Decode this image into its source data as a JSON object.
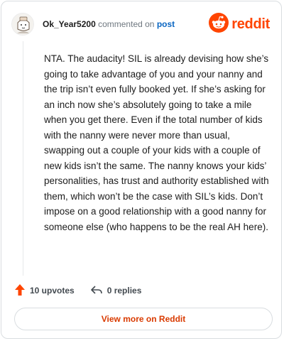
{
  "header": {
    "username": "Ok_Year5200",
    "action_text": "commented on",
    "post_link": "post",
    "brand": "reddit"
  },
  "comment": {
    "text": "NTA. The audacity! SIL is already devising how she’s going to take advantage of you and your nanny and the trip isn’t even fully booked yet. If she’s asking for an inch now she’s absolutely going to take a mile when you get there. Even if the total number of kids with the nanny were never more than usual, swapping out a couple of your kids with a couple of new kids isn’t the same. The nanny knows your kids’ personalities, has trust and authority established with them, which won’t be the case with SIL’s kids. Don’t impose on a good relationship with a good nanny for someone else (who happens to be the real AH here)."
  },
  "actions": {
    "upvotes": "10 upvotes",
    "replies": "0 replies"
  },
  "footer": {
    "view_more": "View more on Reddit"
  },
  "colors": {
    "brand": "#ff4500",
    "link": "#0a66c2",
    "view_more": "#d93a00"
  },
  "icons": [
    "avatar",
    "reddit-logo-icon",
    "upvote-arrow-icon",
    "reply-arrow-icon"
  ]
}
